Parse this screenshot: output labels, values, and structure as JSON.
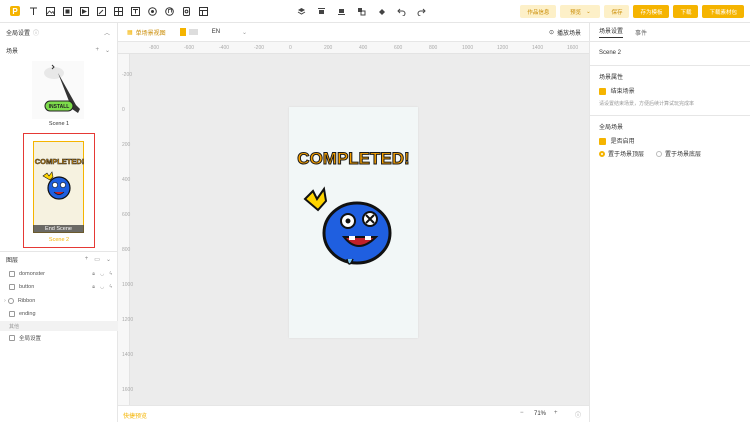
{
  "toolbar": {
    "logo": "P",
    "buttons": {
      "works_info": "作品信息",
      "preview": "预览",
      "save": "保存",
      "save_template": "存为模板",
      "download": "下载",
      "download_bundle": "下载素材包"
    }
  },
  "left": {
    "global_settings": "全局设置",
    "scenes_title": "场景",
    "scenes": [
      {
        "name": "Scene 1",
        "thumb_text": "INSTALL"
      },
      {
        "name": "Scene 2",
        "thumb_text": "COMPLETED!",
        "overlay": "End Scene"
      }
    ],
    "layers_title": "图层",
    "layers": [
      {
        "name": "domonster"
      },
      {
        "name": "button"
      },
      {
        "name": "Ribbon"
      },
      {
        "name": "ending"
      }
    ],
    "other_label": "其他",
    "global_item": "全局设置"
  },
  "canvas": {
    "view_label": "单场景视图",
    "lang": "EN",
    "play_scene": "播放场景",
    "ruler_h": [
      "-800",
      "-600",
      "-400",
      "-200",
      "0",
      "200",
      "400",
      "600",
      "800",
      "1000",
      "1200",
      "1400",
      "1600"
    ],
    "ruler_v": [
      "-200",
      "0",
      "200",
      "400",
      "600",
      "800",
      "1000",
      "1200",
      "1400",
      "1600"
    ],
    "stage_title": "COMPLETED!",
    "shortcut": "快捷预览",
    "zoom": "71%"
  },
  "right": {
    "tabs": [
      "场景设置",
      "事件"
    ],
    "scene_name": "Scene 2",
    "props_title": "场景属性",
    "end_scene": "结束场景",
    "end_scene_desc": "请设置结束场景，方便后续计算试玩完成率",
    "global_title": "全局场景",
    "enabled": "是否启用",
    "top_option": "置于场景顶层",
    "bottom_option": "置于场景底层"
  },
  "colors": {
    "accent": "#f5b400",
    "selected_border": "#e53935",
    "blue_monster": "#1f5fe0"
  }
}
